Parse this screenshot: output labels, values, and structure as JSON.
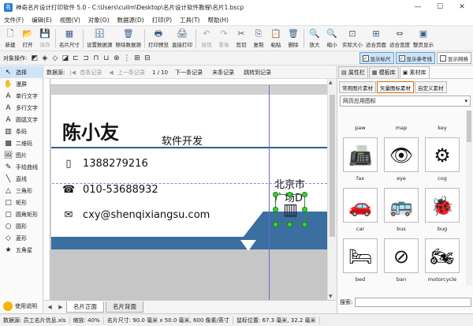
{
  "window": {
    "title": "神奇名片设计打印软件 5.0 - C:\\Users\\cuilm\\Desktop\\名片设计软件教程\\名片1.bscp",
    "min": "—",
    "max": "☐",
    "close": "✕"
  },
  "menu": [
    "文件(F)",
    "编辑(E)",
    "视图(V)",
    "对象(O)",
    "数据源(D)",
    "打印(P)",
    "工具(T)",
    "帮助(H)"
  ],
  "toolbar": [
    {
      "label": "新建",
      "icon": "🗋"
    },
    {
      "label": "打开",
      "icon": "📂"
    },
    {
      "label": "保存",
      "icon": "💾"
    },
    {
      "label": "名片尺寸",
      "icon": "▦"
    },
    {
      "label": "设置数据源",
      "icon": "🗄"
    },
    {
      "label": "移除数据源",
      "icon": "🗑"
    },
    {
      "label": "打印预览",
      "icon": "🖶"
    },
    {
      "label": "直接打印",
      "icon": "🖨"
    },
    {
      "label": "撤销",
      "icon": "↶"
    },
    {
      "label": "重做",
      "icon": "↷"
    },
    {
      "label": "剪切",
      "icon": "✂"
    },
    {
      "label": "复制",
      "icon": "⎘"
    },
    {
      "label": "粘贴",
      "icon": "📋"
    },
    {
      "label": "删除",
      "icon": "🗑"
    },
    {
      "label": "放大",
      "icon": "🔍"
    },
    {
      "label": "缩小",
      "icon": "🔍"
    },
    {
      "label": "实际大小",
      "icon": "⊡"
    },
    {
      "label": "适合页面",
      "icon": "⊞"
    },
    {
      "label": "适合宽度",
      "icon": "⇔"
    },
    {
      "label": "整页显示",
      "icon": "▣"
    }
  ],
  "objbar": {
    "label": "对象操作:",
    "toggles": [
      "显示标尺",
      "显示参考线",
      "显示网格"
    ]
  },
  "left_tools": [
    {
      "label": "选择",
      "icon": "↖"
    },
    {
      "label": "漫屏",
      "icon": "✋"
    },
    {
      "label": "单行文字",
      "icon": "A"
    },
    {
      "label": "多行文字",
      "icon": "A"
    },
    {
      "label": "圆弧文字",
      "icon": "A"
    },
    {
      "label": "条码",
      "icon": "▥"
    },
    {
      "label": "二维码",
      "icon": "▩"
    },
    {
      "label": "图片",
      "icon": "🖼"
    },
    {
      "label": "手绘曲线",
      "icon": "✎"
    },
    {
      "label": "直线",
      "icon": "╲"
    },
    {
      "label": "三角形",
      "icon": "△"
    },
    {
      "label": "矩形",
      "icon": "□"
    },
    {
      "label": "圆角矩形",
      "icon": "▢"
    },
    {
      "label": "圆形",
      "icon": "○"
    },
    {
      "label": "菱形",
      "icon": "◇"
    },
    {
      "label": "五角星",
      "icon": "★"
    }
  ],
  "help": {
    "label": "使用说明"
  },
  "navbar": {
    "label": "数据源:",
    "first": "首条记录",
    "prev": "上一条记录",
    "page": "1 / 10",
    "next": "下一条记录",
    "last": "末条记录",
    "jump": "跳转到记录"
  },
  "card": {
    "name": "陈小友",
    "job": "软件开发",
    "phone": "13882792​16",
    "tel": "010-53688932",
    "email": "cxy@shenqixiangsu.com",
    "addr1": "北京市",
    "addr2": "广场D"
  },
  "canvas_tabs": [
    "名片正面",
    "名片背面"
  ],
  "right_panel": {
    "tabs": [
      "属性栏",
      "模板库",
      "素材库"
    ],
    "subtabs": [
      "常用图片素材",
      "矢量图标素材",
      "自定义素材"
    ],
    "category": "网页应用图标",
    "top_labels": [
      "paw",
      "map",
      "key"
    ],
    "icons": [
      {
        "name": "fax",
        "glyph": "📠"
      },
      {
        "name": "eye",
        "glyph": "👁"
      },
      {
        "name": "cog",
        "glyph": "⚙"
      },
      {
        "name": "car",
        "glyph": "🚗"
      },
      {
        "name": "bus",
        "glyph": "🚌"
      },
      {
        "name": "bug",
        "glyph": "🐞"
      },
      {
        "name": "bed",
        "glyph": "🛏"
      },
      {
        "name": "ban",
        "glyph": "⊘"
      },
      {
        "name": "motorcycle",
        "glyph": "🏍"
      }
    ],
    "search_label": "搜索:"
  },
  "status": {
    "datasource": "数据源: 员工名片信息.xls",
    "zoom": "缩放: 40%",
    "size": "名片尺寸: 90.0 毫米 x 50.0 毫米, 600 像素/英寸",
    "coords": "鼠标位置: 67.3 毫米, 32.2 毫米"
  }
}
